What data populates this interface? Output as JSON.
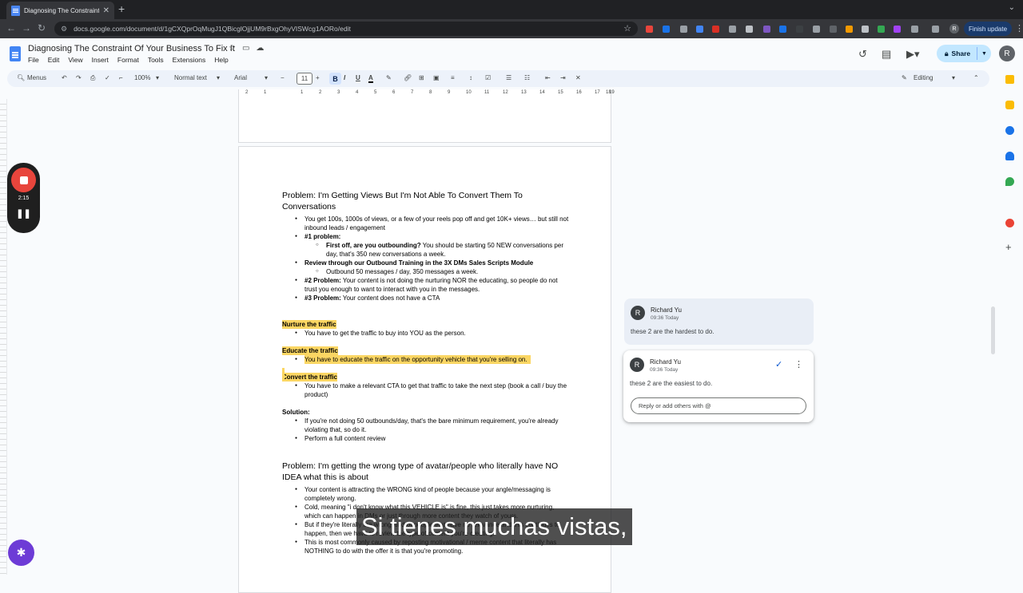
{
  "browser": {
    "tab_title": "Diagnosing The Constraint Of",
    "url": "docs.google.com/document/d/1gCXQprOqMugJ1QBicglOjjUM9rBxgOhyVISWcg1AORo/edit",
    "finish_update": "Finish update",
    "profile_initial": "R"
  },
  "docs": {
    "title": "Diagnosing The Constraint Of Your Business To Fix It",
    "menu": [
      "File",
      "Edit",
      "View",
      "Insert",
      "Format",
      "Tools",
      "Extensions",
      "Help"
    ],
    "share_label": "Share",
    "user_initial": "R"
  },
  "toolbar": {
    "menus_label": "Menus",
    "zoom": "100%",
    "style": "Normal text",
    "font": "Arial",
    "font_size": "11",
    "bold": "B",
    "italic": "I",
    "underline": "U",
    "mode": "Editing"
  },
  "ruler": [
    "2",
    "1",
    "1",
    "2",
    "3",
    "4",
    "5",
    "6",
    "7",
    "8",
    "9",
    "10",
    "11",
    "12",
    "13",
    "14",
    "15",
    "16",
    "17",
    "18",
    "19"
  ],
  "content": {
    "h1": "Problem: I'm Getting Views But I'm Not Able To Convert Them To Conversations",
    "b1": "You get 100s, 1000s of views, or a few of your reels pop off and get 10K+ views… but still not inbound leads / engagement",
    "b2": "#1 problem:",
    "b2a_bold": "First off, are you outbounding?",
    "b2a": " You should be starting 50 NEW conversations per day, that's 350 new conversations a week.",
    "b3": "Review through our Outbound Training in the 3X DMs Sales Scripts Module",
    "b3a": "Outbound 50 messages / day, 350 messages a week.",
    "b4_bold": "#2 Problem:",
    "b4": " Your content is not doing the nurturing NOR the educating, so people do not trust you enough to want to interact with you in the messages.",
    "b5_bold": "#3 Problem:",
    "b5": " Your content does not have a CTA",
    "nurture": "Nurture the traffic",
    "nurture_b": "You have to get the traffic to buy into YOU as the person.",
    "educate": "Educate the traffic",
    "educate_b": "You have to educate the traffic on the opportunity vehicle that you're selling on.",
    "convert": "Convert the traffic",
    "convert_b": "You have to make a relevant CTA to get that traffic to take the next step (book a call / buy the product)",
    "solution": "Solution:",
    "sol1": "If you're not doing 50 outbounds/day, that's the bare minimum requirement, you're already violating that, so do it.",
    "sol2": "Perform a full content review",
    "h2": "Problem: I'm getting the wrong type of avatar/people who literally have NO IDEA what this is about",
    "p1": "Your content is attracting the WRONG kind of people because your angle/messaging is completely wrong.",
    "p2": "Cold, meaning \"i don't know what this VEHICLE is\" is fine, this just takes more nurturing, which can happen in DMs or just through more content they watch of yours.",
    "p3": "But if they're literally the wrong kind of people that have no relevance and this continues to happen, then we have to review the type of content you're creating.",
    "p4": "This is most commonly caused by reposting motivational / meme content that literally has NOTHING to do with the offer it is that you're promoting."
  },
  "comments": [
    {
      "initial": "R",
      "author": "Richard Yu",
      "time": "09:36 Today",
      "text": "these 2 are the hardest to do."
    },
    {
      "initial": "R",
      "author": "Richard Yu",
      "time": "09:36 Today",
      "text": "these 2 are the easiest to do.",
      "reply_placeholder": "Reply or add others with @"
    }
  ],
  "recorder": {
    "time": "2:15"
  },
  "subtitle": "Si tienes muchas vistas,"
}
